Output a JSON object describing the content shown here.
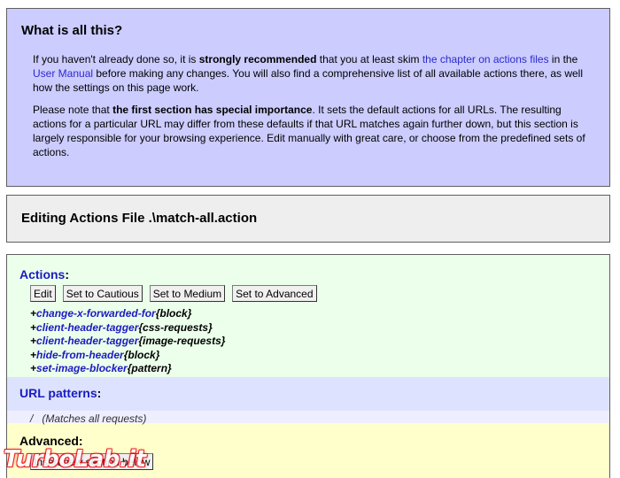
{
  "info": {
    "title": "What is all this?",
    "p1": {
      "t1": "If you haven't already done so, it is ",
      "b1": "strongly recommended",
      "t2": " that you at least skim ",
      "link1": "the chapter on actions files",
      "t3": " in the ",
      "link2": "User Manual",
      "t4": " before making any changes. You will also find a comprehensive list of all available actions there, as well how the settings on this page work."
    },
    "p2": {
      "t1": "Please note that ",
      "b1": "the first section has special importance",
      "t2": ". It sets the default actions for all URLs. The resulting actions for a particular URL may differ from these defaults if that URL matches again further down, but this section is largely responsible for your browsing experience. Edit manually with great care, or choose from the predefined sets of actions."
    }
  },
  "editing": {
    "title": "Editing Actions File .\\match-all.action"
  },
  "actions": {
    "heading": "Actions",
    "colon": ":",
    "buttons": {
      "edit": "Edit",
      "cautious": "Set to Cautious",
      "medium": "Set to Medium",
      "advanced": "Set to Advanced"
    },
    "items": [
      {
        "prefix": "+",
        "name": "change-x-forwarded-for",
        "param": "{block}"
      },
      {
        "prefix": "+",
        "name": "client-header-tagger",
        "param": "{css-requests}"
      },
      {
        "prefix": "+",
        "name": "client-header-tagger",
        "param": "{image-requests}"
      },
      {
        "prefix": "+",
        "name": "hide-from-header",
        "param": "{block}"
      },
      {
        "prefix": "+",
        "name": "set-image-blocker",
        "param": "{pattern}"
      }
    ]
  },
  "url_patterns": {
    "heading": "URL patterns",
    "colon": ":",
    "rows": [
      {
        "pattern": "/",
        "note": "(Matches all requests)"
      }
    ]
  },
  "advanced": {
    "heading": "Advanced:",
    "insert_button": "Insert new section below"
  },
  "watermark": {
    "text": "TurboLab.it"
  },
  "colors": {
    "info_bg": "#ccccff",
    "link": "#2a2acc",
    "actions_bg": "#ebffeb",
    "url_bg": "#dde3ff",
    "advanced_bg": "#ffffcc",
    "watermark": "#e8000b"
  }
}
